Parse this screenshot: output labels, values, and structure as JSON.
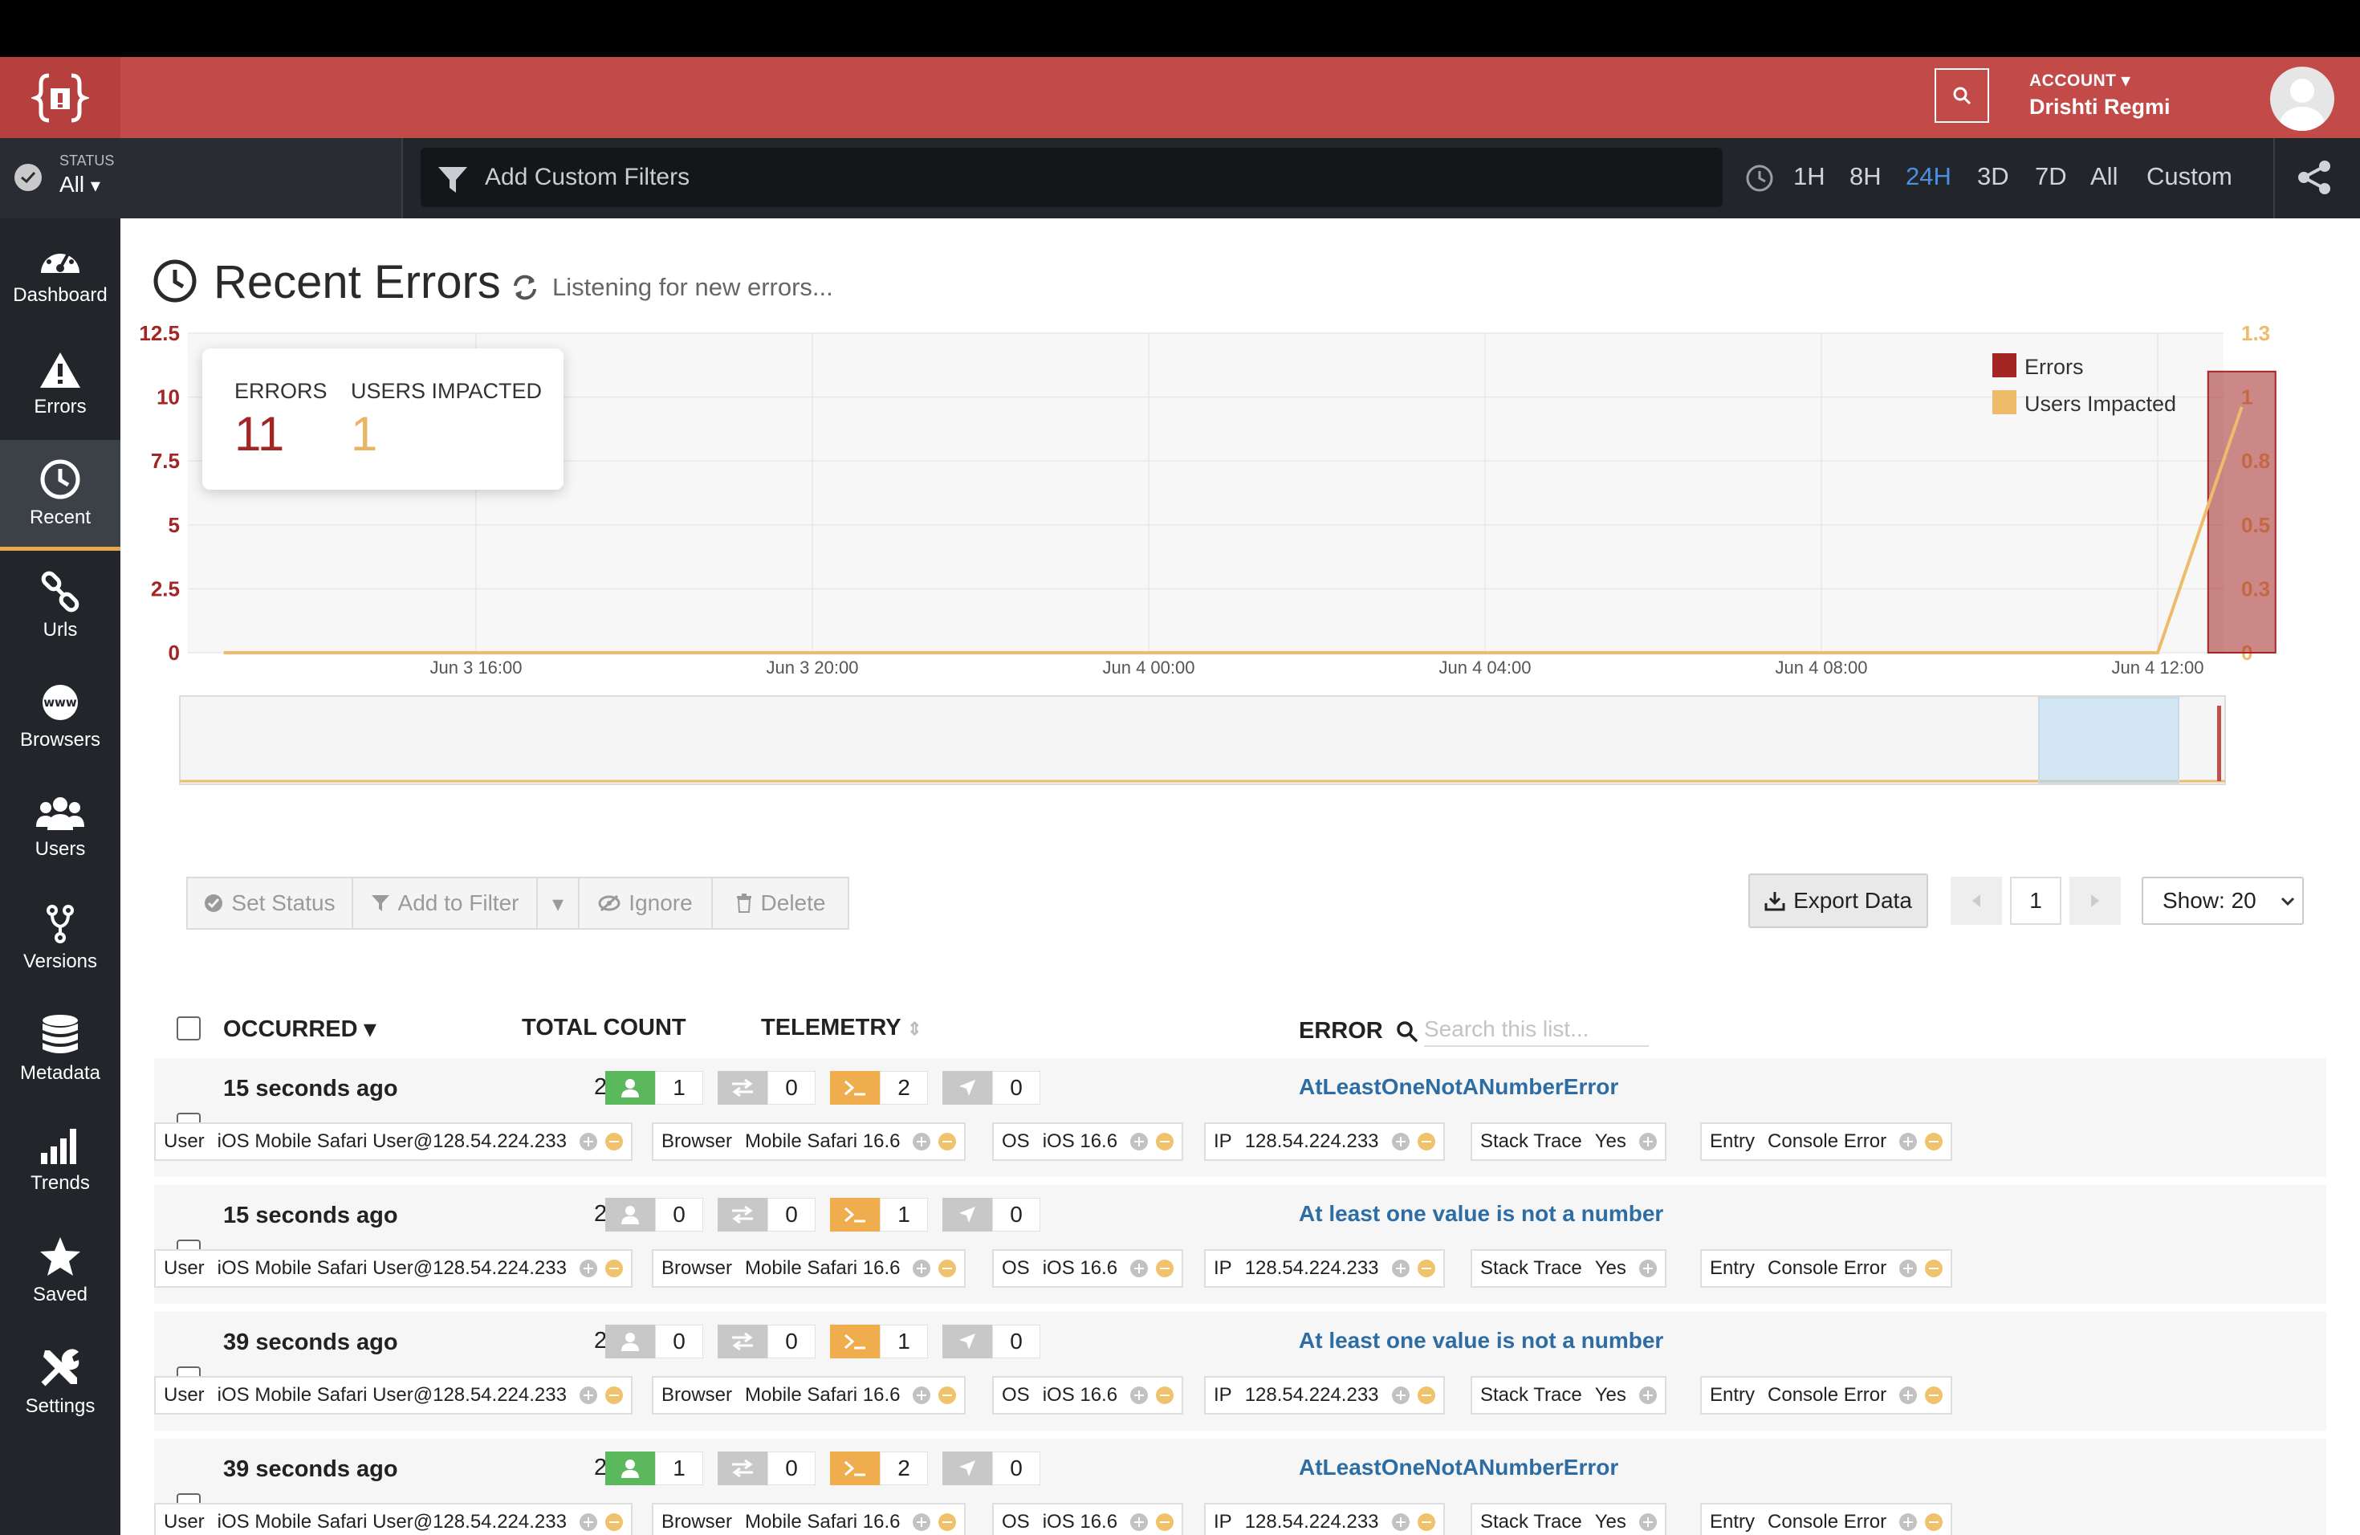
{
  "header": {
    "account_label": "ACCOUNT",
    "account_name": "Drishti Regmi"
  },
  "subbar": {
    "status_label": "STATUS",
    "status_value": "All",
    "filter_placeholder": "Add Custom Filters",
    "ranges": [
      "1H",
      "8H",
      "24H",
      "3D",
      "7D",
      "All",
      "Custom"
    ],
    "active_range": "24H"
  },
  "sidebar": {
    "items": [
      {
        "label": "Dashboard",
        "icon": "gauge-icon"
      },
      {
        "label": "Errors",
        "icon": "warning-icon"
      },
      {
        "label": "Recent",
        "icon": "clock-icon"
      },
      {
        "label": "Urls",
        "icon": "link-icon"
      },
      {
        "label": "Browsers",
        "icon": "www-icon"
      },
      {
        "label": "Users",
        "icon": "users-icon"
      },
      {
        "label": "Versions",
        "icon": "branch-icon"
      },
      {
        "label": "Metadata",
        "icon": "database-icon"
      },
      {
        "label": "Trends",
        "icon": "bar-chart-icon"
      },
      {
        "label": "Saved",
        "icon": "star-icon"
      },
      {
        "label": "Settings",
        "icon": "tools-icon"
      }
    ],
    "active": "Recent"
  },
  "page": {
    "title": "Recent Errors",
    "listening": "Listening for new errors..."
  },
  "summary": {
    "errors_label": "ERRORS",
    "errors_value": "11",
    "users_label": "USERS IMPACTED",
    "users_value": "1"
  },
  "chart_data": {
    "type": "bar",
    "x_ticks": [
      "Jun 3 16:00",
      "Jun 3 20:00",
      "Jun 4 00:00",
      "Jun 4 04:00",
      "Jun 4 08:00",
      "Jun 4 12:00"
    ],
    "y_left_ticks": [
      "12.5",
      "10",
      "7.5",
      "5",
      "2.5",
      "0"
    ],
    "y_right_ticks": [
      "1.3",
      "1",
      "0.8",
      "0.5",
      "0.3",
      "0"
    ],
    "ylim_left": [
      0,
      12.5
    ],
    "ylim_right": [
      0,
      1.3
    ],
    "series": [
      {
        "name": "Errors",
        "color": "#a32524",
        "axis": "left",
        "kind": "bar",
        "points": [
          {
            "x": "Jun 4 13:00",
            "y": 11
          }
        ]
      },
      {
        "name": "Users Impacted",
        "color": "#eebb6b",
        "axis": "right",
        "kind": "line",
        "points": [
          {
            "x": "Jun 3 13:00",
            "y": 0
          },
          {
            "x": "Jun 4 12:00",
            "y": 0
          },
          {
            "x": "Jun 4 13:00",
            "y": 1
          }
        ]
      }
    ],
    "legend": [
      "Errors",
      "Users Impacted"
    ],
    "legend_position": "top-right",
    "grid": true
  },
  "actions": {
    "set_status": "Set Status",
    "add_filter": "Add to Filter",
    "ignore": "Ignore",
    "delete": "Delete",
    "export": "Export Data",
    "page": "1",
    "show": "Show: 20"
  },
  "table": {
    "headers": {
      "occurred": "OCCURRED",
      "total_count": "TOTAL COUNT",
      "telemetry": "TELEMETRY",
      "error": "ERROR"
    },
    "search_placeholder": "Search this list...",
    "rows": [
      {
        "time": "15 seconds ago",
        "count": "2",
        "tel_user": "1",
        "tel_net": "0",
        "tel_console": "2",
        "tel_nav": "0",
        "error": "AtLeastOneNotANumberError",
        "tags": {
          "user_k": "User",
          "user_v": "iOS Mobile Safari User@128.54.224.233",
          "browser_k": "Browser",
          "browser_v": "Mobile Safari 16.6",
          "os_k": "OS",
          "os_v": "iOS 16.6",
          "ip_k": "IP",
          "ip_v": "128.54.224.233",
          "stack_k": "Stack Trace",
          "stack_v": "Yes",
          "entry_k": "Entry",
          "entry_v": "Console Error"
        }
      },
      {
        "time": "15 seconds ago",
        "count": "2",
        "tel_user": "0",
        "tel_net": "0",
        "tel_console": "1",
        "tel_nav": "0",
        "error": "At least one value is not a number",
        "tags": {
          "user_k": "User",
          "user_v": "iOS Mobile Safari User@128.54.224.233",
          "browser_k": "Browser",
          "browser_v": "Mobile Safari 16.6",
          "os_k": "OS",
          "os_v": "iOS 16.6",
          "ip_k": "IP",
          "ip_v": "128.54.224.233",
          "stack_k": "Stack Trace",
          "stack_v": "Yes",
          "entry_k": "Entry",
          "entry_v": "Console Error"
        }
      },
      {
        "time": "39 seconds ago",
        "count": "2",
        "tel_user": "0",
        "tel_net": "0",
        "tel_console": "1",
        "tel_nav": "0",
        "error": "At least one value is not a number",
        "tags": {
          "user_k": "User",
          "user_v": "iOS Mobile Safari User@128.54.224.233",
          "browser_k": "Browser",
          "browser_v": "Mobile Safari 16.6",
          "os_k": "OS",
          "os_v": "iOS 16.6",
          "ip_k": "IP",
          "ip_v": "128.54.224.233",
          "stack_k": "Stack Trace",
          "stack_v": "Yes",
          "entry_k": "Entry",
          "entry_v": "Console Error"
        }
      },
      {
        "time": "39 seconds ago",
        "count": "2",
        "tel_user": "1",
        "tel_net": "0",
        "tel_console": "2",
        "tel_nav": "0",
        "error": "AtLeastOneNotANumberError",
        "tags": {
          "user_k": "User",
          "user_v": "iOS Mobile Safari User@128.54.224.233",
          "browser_k": "Browser",
          "browser_v": "Mobile Safari 16.6",
          "os_k": "OS",
          "os_v": "iOS 16.6",
          "ip_k": "IP",
          "ip_v": "128.54.224.233",
          "stack_k": "Stack Trace",
          "stack_v": "Yes",
          "entry_k": "Entry",
          "entry_v": "Console Error"
        }
      }
    ]
  }
}
